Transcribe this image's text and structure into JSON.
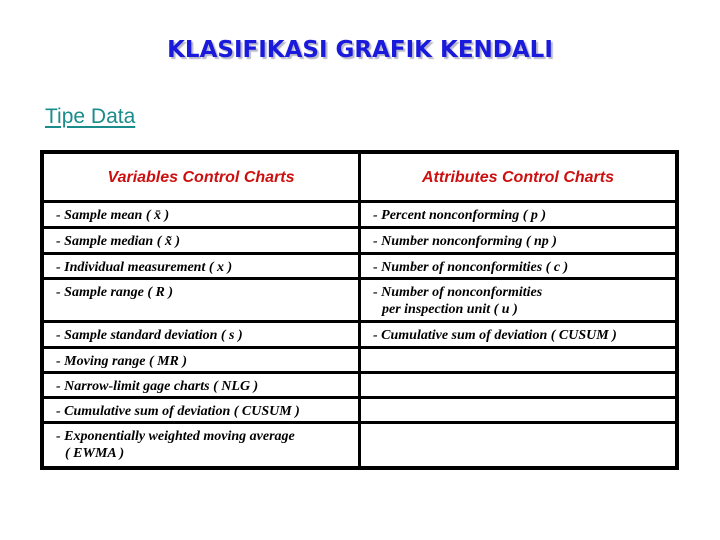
{
  "page": {
    "title": "KLASIFIKASI GRAFIK KENDALI",
    "section_heading": "Tipe Data"
  },
  "table": {
    "headers": [
      "Variables Control Charts",
      "Attributes Control Charts"
    ],
    "rows": [
      {
        "variables": "- Sample mean ( x̄ )",
        "attributes": "- Percent nonconforming ( p )"
      },
      {
        "variables": "- Sample median ( x̃ )",
        "attributes": "- Number nonconforming ( np )"
      },
      {
        "variables": "- Individual measurement ( x )",
        "attributes": "- Number of nonconformities ( c )"
      },
      {
        "variables": "- Sample range ( R )",
        "attributes": "- Number of nonconformities",
        "attributes_line2": "per inspection unit ( u )"
      },
      {
        "variables": "- Sample standard deviation ( s )",
        "attributes": "- Cumulative sum of deviation ( CUSUM )"
      },
      {
        "variables": "- Moving range ( MR )",
        "attributes": ""
      },
      {
        "variables": "- Narrow-limit gage charts ( NLG )",
        "attributes": ""
      },
      {
        "variables": "- Cumulative sum of deviation ( CUSUM )",
        "attributes": ""
      },
      {
        "variables": "- Exponentially weighted moving average",
        "variables_line2": "( EWMA )",
        "attributes": ""
      }
    ]
  },
  "colors": {
    "title": "#1a1adc",
    "section_heading": "#1a8c8c",
    "table_header": "#cc1010",
    "border": "#000000"
  }
}
